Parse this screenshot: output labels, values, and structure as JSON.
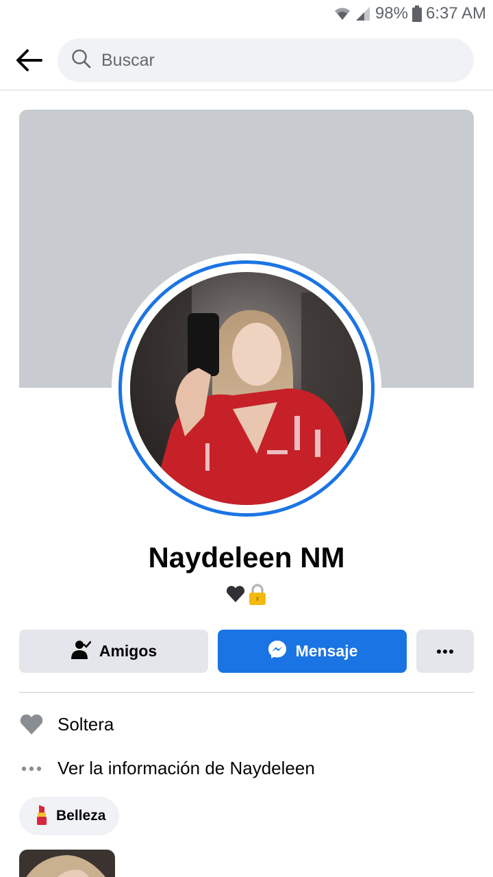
{
  "status_bar": {
    "battery": "98%",
    "time": "6:37 AM"
  },
  "search": {
    "placeholder": "Buscar"
  },
  "profile": {
    "name": "Naydeleen NM",
    "bio_emojis": [
      "🖤",
      "🔒"
    ]
  },
  "actions": {
    "friends_label": "Amigos",
    "message_label": "Mensaje"
  },
  "info": {
    "relationship": "Soltera",
    "see_about": "Ver la información de Naydeleen"
  },
  "interests": [
    {
      "emoji": "💄",
      "label": "Belleza"
    }
  ],
  "colors": {
    "accent": "#1b74e4",
    "cover": "#c8ccd0",
    "button_gray": "#e4e6eb",
    "search_bg": "#f0f2f5"
  }
}
